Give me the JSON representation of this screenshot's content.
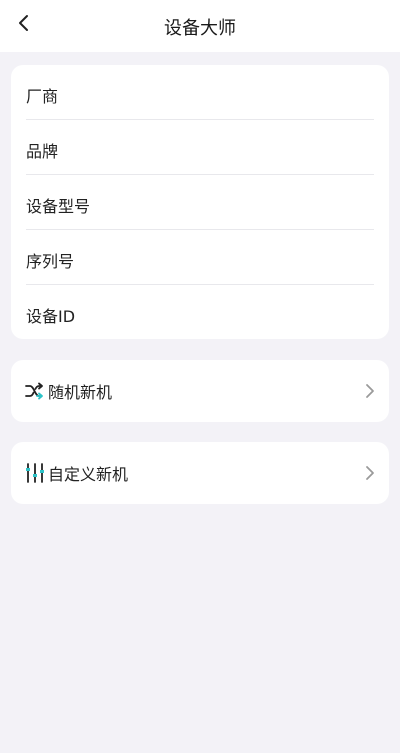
{
  "header": {
    "title": "设备大师",
    "back_icon": "chevron-left-icon"
  },
  "info_card": {
    "fields": [
      {
        "label": "厂商"
      },
      {
        "label": "品牌"
      },
      {
        "label": "设备型号"
      },
      {
        "label": "序列号"
      },
      {
        "label": "设备ID"
      }
    ]
  },
  "actions": {
    "random": {
      "label": "随机新机",
      "icon": "shuffle-icon"
    },
    "custom": {
      "label": "自定义新机",
      "icon": "sliders-icon"
    }
  },
  "colors": {
    "background": "#f3f2f7",
    "card": "#ffffff",
    "accent": "#2ec3c8",
    "chevron": "#9a9a9a"
  }
}
